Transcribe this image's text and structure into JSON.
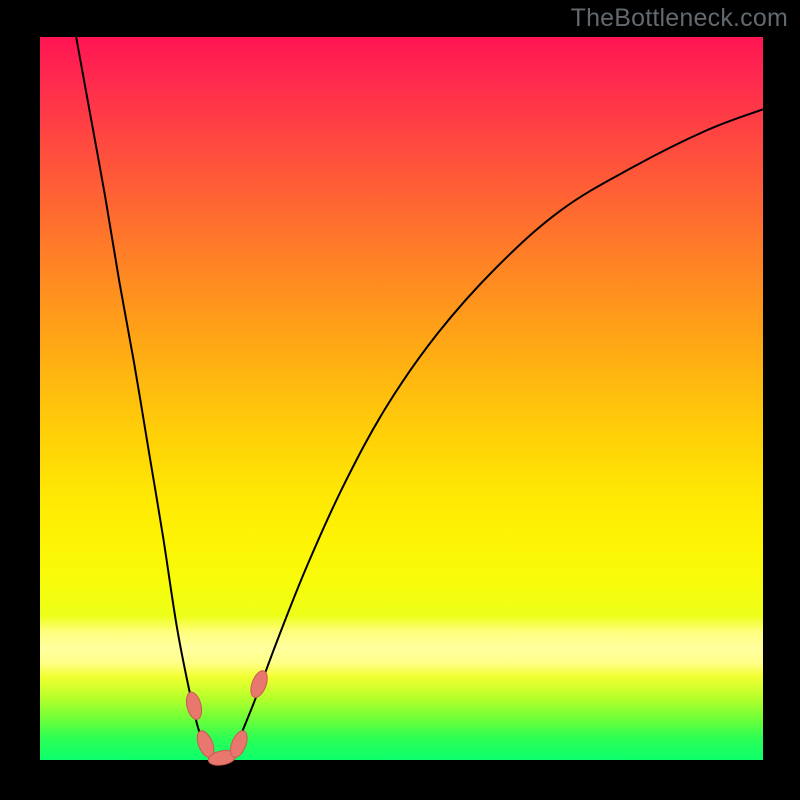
{
  "watermark": "TheBottleneck.com",
  "chart_data": {
    "type": "line",
    "title": "",
    "xlabel": "",
    "ylabel": "",
    "xlim": [
      0,
      100
    ],
    "ylim": [
      0,
      100
    ],
    "background": "red-to-green vertical gradient (bottleneck heatmap)",
    "series": [
      {
        "name": "bottleneck-curve",
        "x": [
          5,
          7,
          9,
          11,
          13,
          15,
          17,
          19,
          21,
          22,
          23,
          24,
          25,
          26,
          27,
          28,
          30,
          33,
          37,
          42,
          48,
          55,
          63,
          72,
          82,
          92,
          100
        ],
        "y": [
          100,
          89,
          78,
          66,
          55,
          43,
          31,
          18,
          8,
          4,
          1.5,
          0.5,
          0.3,
          0.5,
          1.5,
          4,
          9,
          17,
          27,
          38,
          49,
          59,
          68,
          76,
          82,
          87,
          90
        ]
      }
    ],
    "markers": [
      {
        "name": "marker-1",
        "x": 21.3,
        "y": 7.5
      },
      {
        "name": "marker-2",
        "x": 22.9,
        "y": 2.2
      },
      {
        "name": "marker-3",
        "x": 25.2,
        "y": 0.3
      },
      {
        "name": "marker-4",
        "x": 27.5,
        "y": 2.2
      },
      {
        "name": "marker-5",
        "x": 30.3,
        "y": 10.5
      }
    ],
    "marker_style": {
      "color": "#e8776e",
      "rx": 7,
      "ry": 14,
      "stroke": "#c95b52"
    },
    "curve_style": {
      "stroke": "#000000",
      "width": 2
    }
  }
}
